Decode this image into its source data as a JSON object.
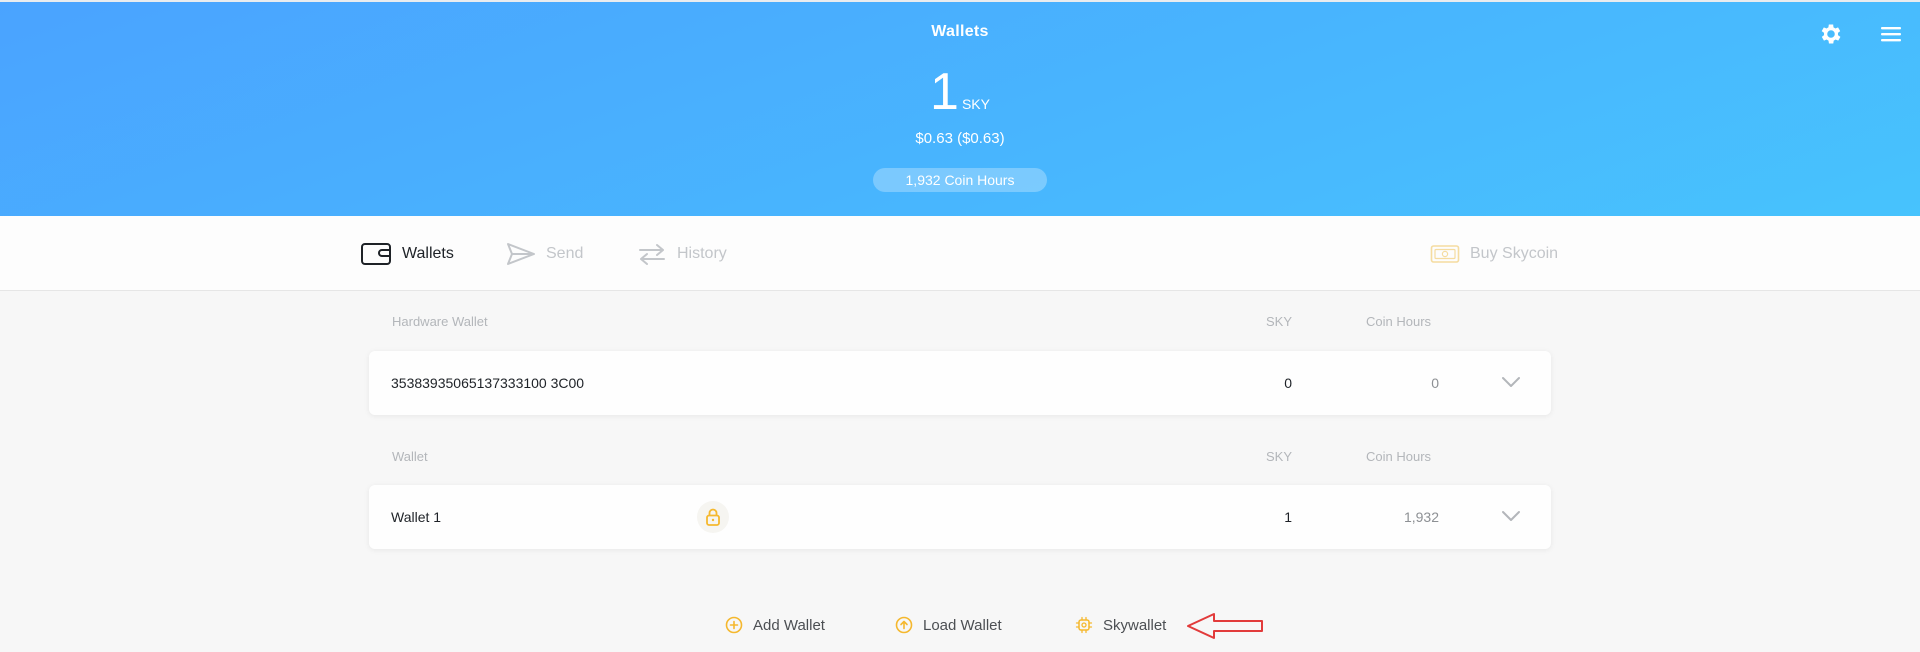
{
  "header": {
    "title": "Wallets",
    "balance": {
      "amount": "1",
      "unit": "SKY",
      "usd": "$0.63 ($0.63)"
    },
    "coin_hours_pill": "1,932 Coin Hours",
    "icons": [
      "gear-icon",
      "hamburger-menu-icon"
    ]
  },
  "nav": {
    "wallets": "Wallets",
    "send": "Send",
    "history": "History",
    "buy": "Buy Skycoin"
  },
  "hardware_section": {
    "col_name": "Hardware Wallet",
    "col_sky": "SKY",
    "col_hours": "Coin Hours",
    "rows": [
      {
        "name": "35383935065137333100 3C00",
        "sky": "0",
        "hours": "0"
      }
    ]
  },
  "wallet_section": {
    "col_name": "Wallet",
    "col_sky": "SKY",
    "col_hours": "Coin Hours",
    "rows": [
      {
        "name": "Wallet 1",
        "sky": "1",
        "hours": "1,932",
        "encrypted": true
      }
    ]
  },
  "actions": {
    "add_wallet": "Add Wallet",
    "load_wallet": "Load Wallet",
    "skywallet": "Skywallet"
  },
  "colors": {
    "header_gradient_start": "#4aa3ff",
    "header_gradient_end": "#47c3fd",
    "accent_yellow": "#f5b82e",
    "annotation_arrow": "#e23b3b"
  }
}
